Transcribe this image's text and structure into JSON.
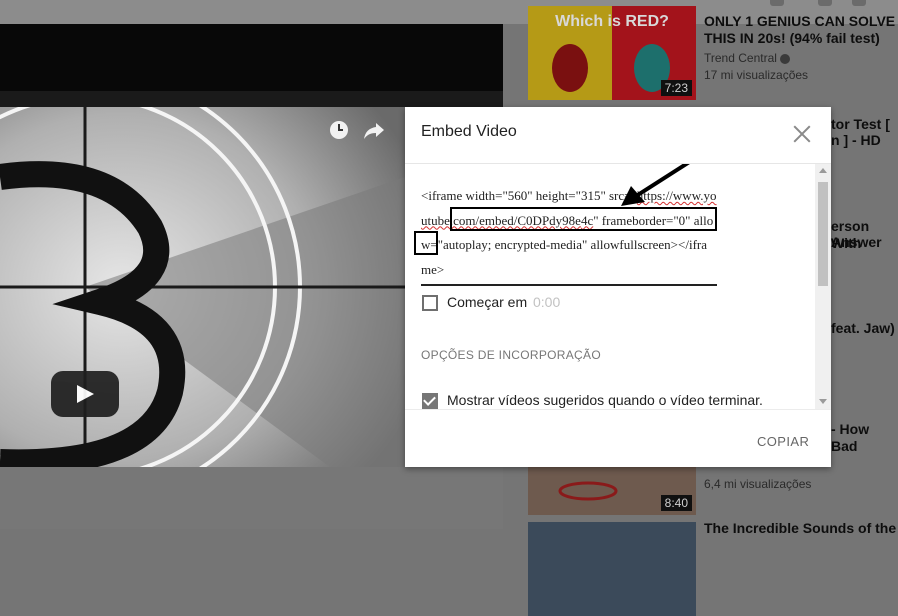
{
  "dialog": {
    "title": "Embed Video",
    "code": {
      "part1": "<iframe width=\"560\" height=\"315\" src=\"",
      "url_a": "https://www.youtube.com/embed/C0DPdy98e",
      "url_b": "4c",
      "part2": "\" frameborder=\"0\" allow=\"autoplay; encrypted-media\" allowfullscreen></iframe>"
    },
    "start_label": "Começar em",
    "start_time": "0:00",
    "start_checked": false,
    "section_title": "OPÇÕES DE INCORPORAÇÃO",
    "suggest_label": "Mostrar vídeos sugeridos quando o vídeo terminar.",
    "suggest_checked": true,
    "copy_label": "COPIAR"
  },
  "sidebar": {
    "items": [
      {
        "title_1": "ONLY 1 GENIUS CAN SOLVE",
        "title_2": "THIS IN 20s! (94% fail test)",
        "channel": "Trend Central",
        "views": "17 mi visualizações",
        "duration": "7:23",
        "thumb_text": "Which is RED?"
      },
      {
        "frag_1": "tor Test [",
        "frag_2": "n ] - HD"
      },
      {
        "frag_1": "erson With",
        "frag_2": "Answer"
      },
      {
        "frag_1": "feat. Jaw)"
      },
      {
        "frag_1": "- How Bad"
      },
      {
        "views": "6,4 mi visualizações",
        "duration": "8:40"
      },
      {
        "title_1": "The Incredible Sounds of the"
      }
    ]
  },
  "icons": {
    "clock": "clock-icon",
    "share": "share-icon",
    "play": "play-icon",
    "close": "close-icon"
  },
  "colors": {
    "dim_overlay": "#757575",
    "dialog_bg": "#ffffff",
    "squiggle": "#d32f2f"
  }
}
